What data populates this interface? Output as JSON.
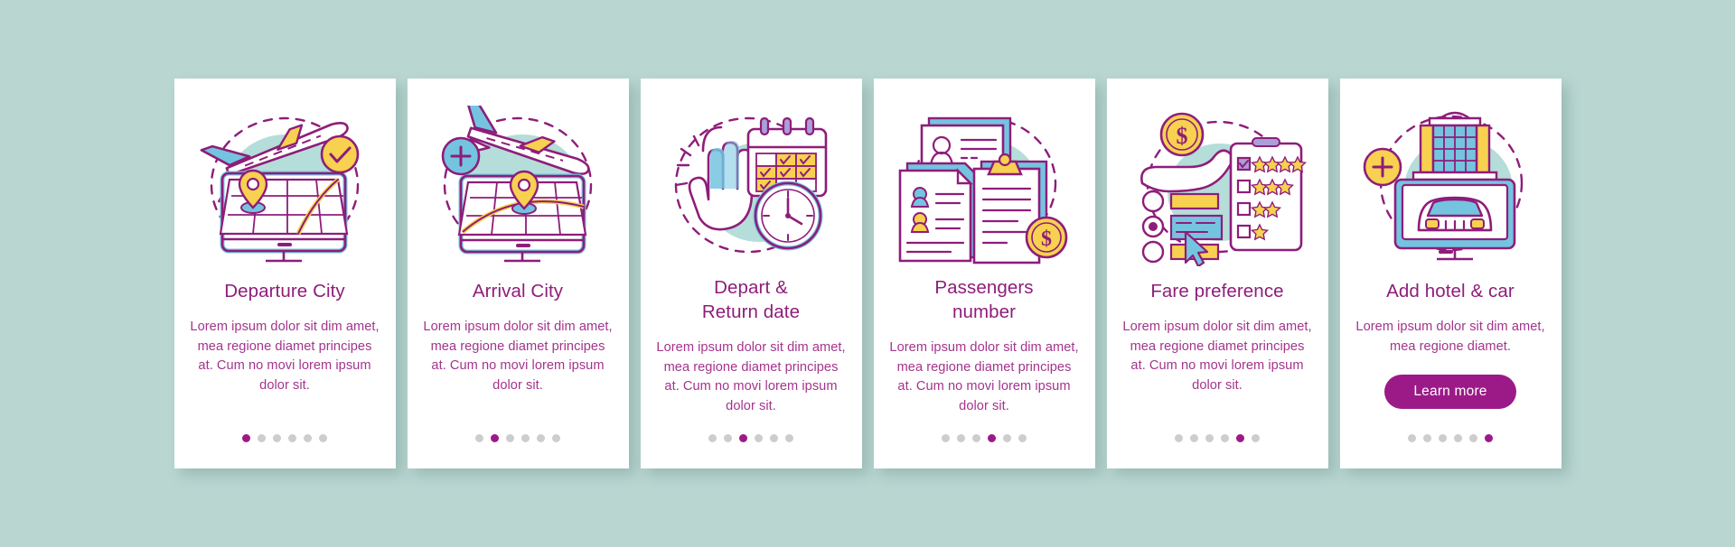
{
  "background_color": "#b9d6d1",
  "accent_color": "#9c1a87",
  "title_color": "#8e1d7a",
  "body_color": "#a4338c",
  "total_steps": 6,
  "cards": [
    {
      "id": "departure-city",
      "icon": "airplane-map-monitor-check-icon",
      "title": "Departure City",
      "body": "Lorem ipsum dolor sit dim amet, mea regione diamet principes at. Cum no movi lorem ipsum dolor sit.",
      "active_step": 1,
      "cta": null
    },
    {
      "id": "arrival-city",
      "icon": "airplane-map-monitor-plus-icon",
      "title": "Arrival City",
      "body": "Lorem ipsum dolor sit dim amet, mea regione diamet principes at. Cum no movi lorem ipsum dolor sit.",
      "active_step": 2,
      "cta": null
    },
    {
      "id": "depart-return-date",
      "icon": "hand-calendar-clock-icon",
      "title": "Depart & Return date",
      "title_lines": [
        "Depart &",
        "Return date"
      ],
      "body": "Lorem ipsum dolor sit dim amet, mea regione diamet principes at. Cum no movi lorem ipsum dolor sit.",
      "active_step": 3,
      "cta": null
    },
    {
      "id": "passengers-number",
      "icon": "passenger-documents-clipboard-coin-icon",
      "title": "Passengers number",
      "title_lines": [
        "Passengers",
        "number"
      ],
      "body": "Lorem ipsum dolor sit dim amet, mea regione diamet principes at. Cum no movi lorem ipsum dolor sit.",
      "active_step": 4,
      "cta": null
    },
    {
      "id": "fare-preference",
      "icon": "hand-coin-rating-list-cursor-icon",
      "title": "Fare preference",
      "body": "Lorem ipsum dolor sit dim amet, mea regione diamet principes at. Cum no movi lorem ipsum dolor sit.",
      "active_step": 5,
      "cta": null
    },
    {
      "id": "add-hotel-and-car",
      "icon": "hotel-car-monitor-plus-icon",
      "title": "Add hotel & car",
      "body": "Lorem ipsum dolor sit dim amet, mea regione diamet.",
      "active_step": 6,
      "cta": "Learn more"
    }
  ]
}
